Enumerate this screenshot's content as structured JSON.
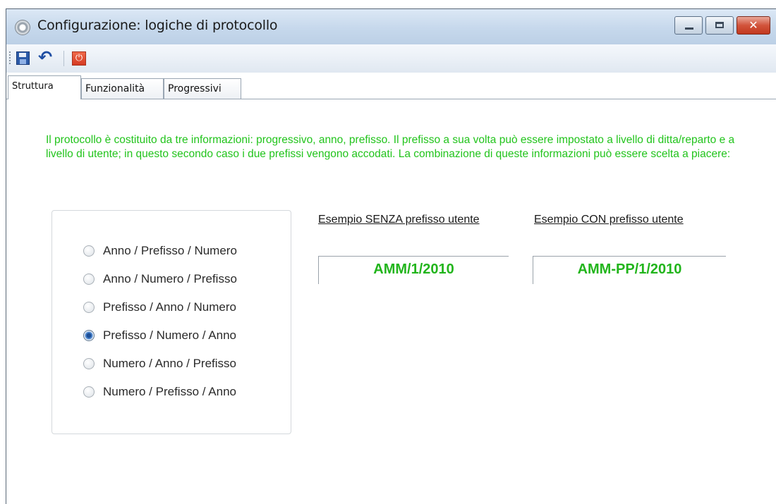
{
  "window": {
    "title": "Configurazione: logiche di protocollo",
    "close_glyph": "✕",
    "icon": "gear-icon"
  },
  "toolbar": {
    "save_icon": "save-icon",
    "undo_icon": "undo-icon",
    "undo_glyph": "↶",
    "exit_icon": "power-icon",
    "exit_glyph": "⏻"
  },
  "tabs": [
    {
      "label": "Struttura",
      "active": true
    },
    {
      "label": "Funzionalità",
      "active": false
    },
    {
      "label": "Progressivi",
      "active": false
    }
  ],
  "description": "Il protocollo è costituito da tre informazioni: progressivo, anno, prefisso. Il prefisso a sua volta può essere impostato a livello di ditta/reparto e a livello di utente; in questo secondo caso i due prefissi vengono accodati. La combinazione di queste informazioni può essere scelta a piacere:",
  "options": [
    {
      "label": "Anno / Prefisso / Numero",
      "checked": false
    },
    {
      "label": "Anno / Numero / Prefisso",
      "checked": false
    },
    {
      "label": "Prefisso / Anno / Numero",
      "checked": false
    },
    {
      "label": "Prefisso / Numero / Anno",
      "checked": true
    },
    {
      "label": "Numero / Anno / Prefisso",
      "checked": false
    },
    {
      "label": "Numero / Prefisso / Anno",
      "checked": false
    }
  ],
  "examples": {
    "without_label": "Esempio SENZA prefisso utente",
    "without_value": "AMM/1/2010",
    "with_label": "Esempio CON prefisso utente",
    "with_value": "AMM-PP/1/2010"
  },
  "colors": {
    "accent_green": "#22c41c",
    "titlebar": "#c6d8ec",
    "close_button": "#c2391f"
  }
}
